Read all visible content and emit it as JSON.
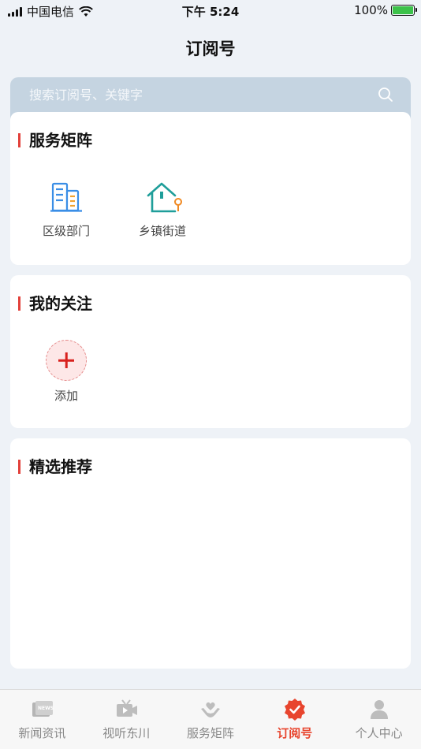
{
  "status_bar": {
    "carrier": "中国电信",
    "time": "下午 5:24",
    "battery": "100%"
  },
  "header": {
    "title": "订阅号"
  },
  "search": {
    "placeholder": "搜索订阅号、关键字"
  },
  "sections": {
    "service_matrix": {
      "title": "服务矩阵",
      "items": [
        {
          "label": "区级部门",
          "icon": "building-icon"
        },
        {
          "label": "乡镇街道",
          "icon": "house-icon"
        }
      ]
    },
    "my_follows": {
      "title": "我的关注",
      "add_label": "添加"
    },
    "recommended": {
      "title": "精选推荐"
    }
  },
  "tab_bar": {
    "active_index": 3,
    "tabs": [
      {
        "label": "新闻资讯",
        "icon": "news-icon"
      },
      {
        "label": "视听东川",
        "icon": "tv-icon"
      },
      {
        "label": "服务矩阵",
        "icon": "heart-hands-icon"
      },
      {
        "label": "订阅号",
        "icon": "verified-badge-icon"
      },
      {
        "label": "个人中心",
        "icon": "person-icon"
      }
    ]
  },
  "colors": {
    "accent": "#e8452e",
    "section_marker": "#e2403a",
    "search_bg": "#c5d4e1",
    "page_bg": "#eef2f7"
  }
}
